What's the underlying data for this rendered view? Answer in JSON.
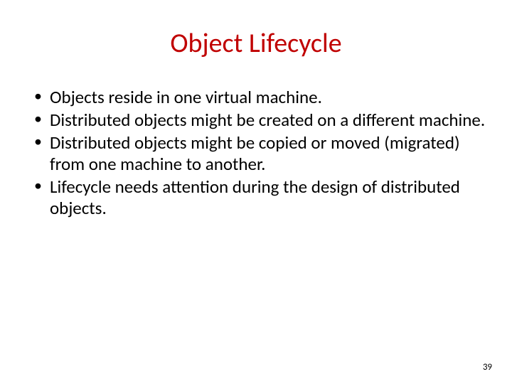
{
  "slide": {
    "title": "Object Lifecycle",
    "bullets": [
      "Objects reside in one virtual machine.",
      "Distributed objects might be created on a different machine.",
      "Distributed objects might be copied or moved (migrated) from one machine to another.",
      "Lifecycle needs attention during the design of distributed objects."
    ],
    "page_number": "39"
  }
}
